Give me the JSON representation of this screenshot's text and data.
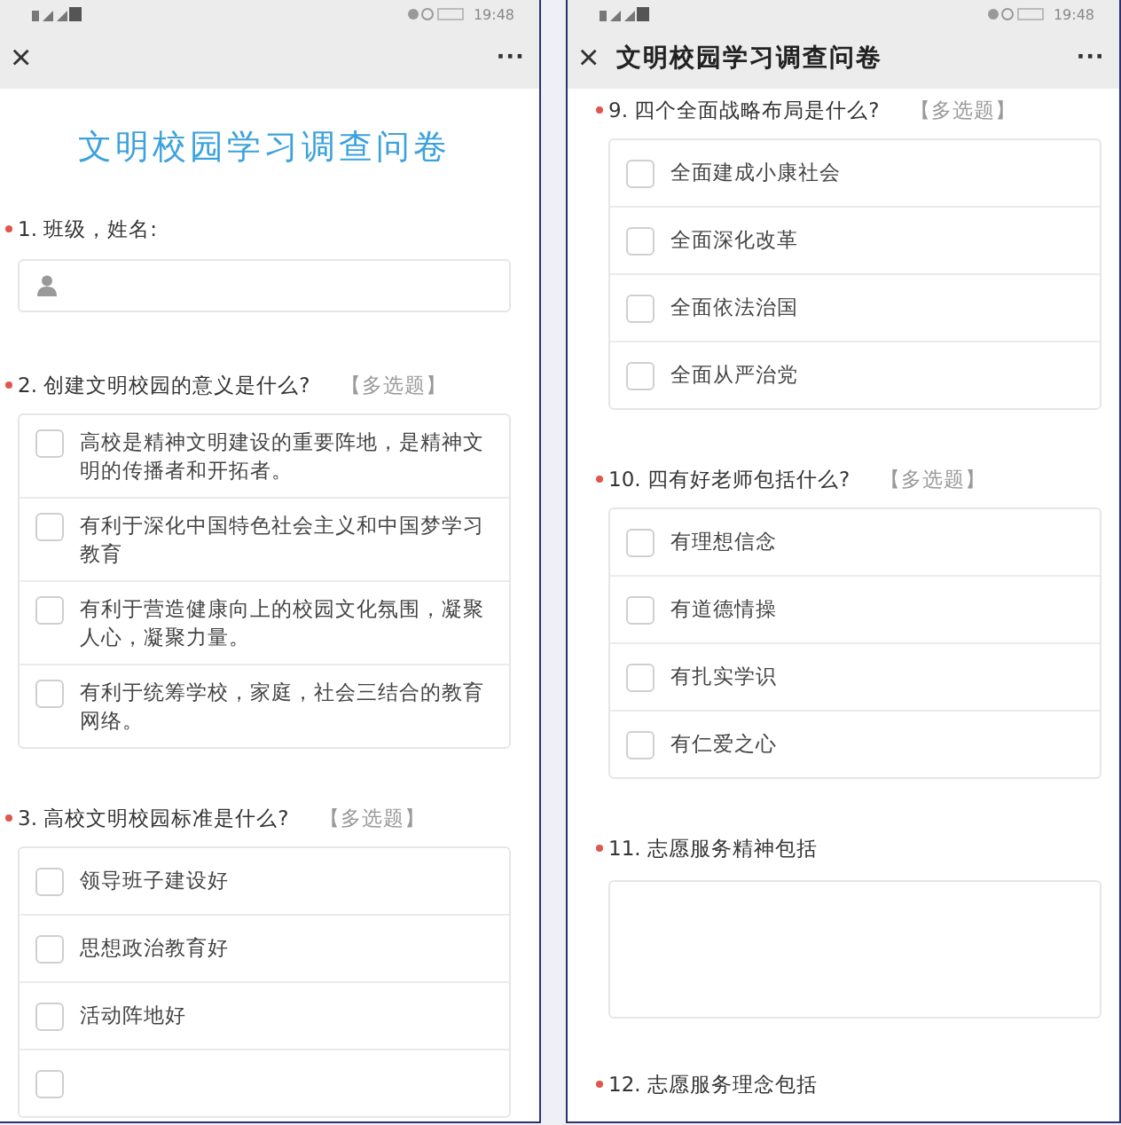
{
  "panels": [
    {
      "status_bar": {
        "time": "19:48"
      },
      "nav": {
        "close": "×",
        "more": "···"
      },
      "survey_title": "文明校园学习调查问卷",
      "questions": [
        {
          "kind": "text",
          "required": true,
          "number": "1.",
          "label": "班级，姓名:"
        },
        {
          "kind": "choice",
          "required": true,
          "number": "2.",
          "label": "创建文明校园的意义是什么?",
          "tag": "【多选题】",
          "options": [
            {
              "label": "高校是精神文明建设的重要阵地，是精神文明的传播者和开拓者。",
              "checked": false
            },
            {
              "label": "有利于深化中国特色社会主义和中国梦学习教育",
              "checked": false
            },
            {
              "label": "有利于营造健康向上的校园文化氛围，凝聚人心，凝聚力量。",
              "checked": false
            },
            {
              "label": "有利于统筹学校，家庭，社会三结合的教育网络。",
              "checked": false
            }
          ]
        },
        {
          "kind": "choice",
          "required": true,
          "number": "3.",
          "label": "高校文明校园标准是什么?",
          "tag": "【多选题】",
          "cut_off": true,
          "options": [
            {
              "label": "领导班子建设好",
              "checked": false
            },
            {
              "label": "思想政治教育好",
              "checked": false
            },
            {
              "label": "活动阵地好",
              "checked": false
            }
          ]
        }
      ]
    },
    {
      "status_bar": {
        "time": "19:48"
      },
      "nav": {
        "close": "×",
        "title": "文明校园学习调查问卷",
        "more": "···"
      },
      "questions": [
        {
          "kind": "choice",
          "required": true,
          "number": "9.",
          "label": "四个全面战略布局是什么?",
          "tag": "【多选题】",
          "options": [
            {
              "label": "全面建成小康社会",
              "checked": false
            },
            {
              "label": "全面深化改革",
              "checked": false
            },
            {
              "label": "全面依法治国",
              "checked": false
            },
            {
              "label": "全面从严治党",
              "checked": false
            }
          ]
        },
        {
          "kind": "choice",
          "required": true,
          "number": "10.",
          "label": "四有好老师包括什么?",
          "tag": "【多选题】",
          "options": [
            {
              "label": "有理想信念",
              "checked": false
            },
            {
              "label": "有道德情操",
              "checked": false
            },
            {
              "label": "有扎实学识",
              "checked": false
            },
            {
              "label": "有仁爱之心",
              "checked": false
            }
          ]
        },
        {
          "kind": "textarea",
          "required": true,
          "number": "11.",
          "label": "志愿服务精神包括"
        },
        {
          "kind": "textarea",
          "required": true,
          "number": "12.",
          "label": "志愿服务理念包括",
          "cut_off": true
        }
      ]
    }
  ]
}
